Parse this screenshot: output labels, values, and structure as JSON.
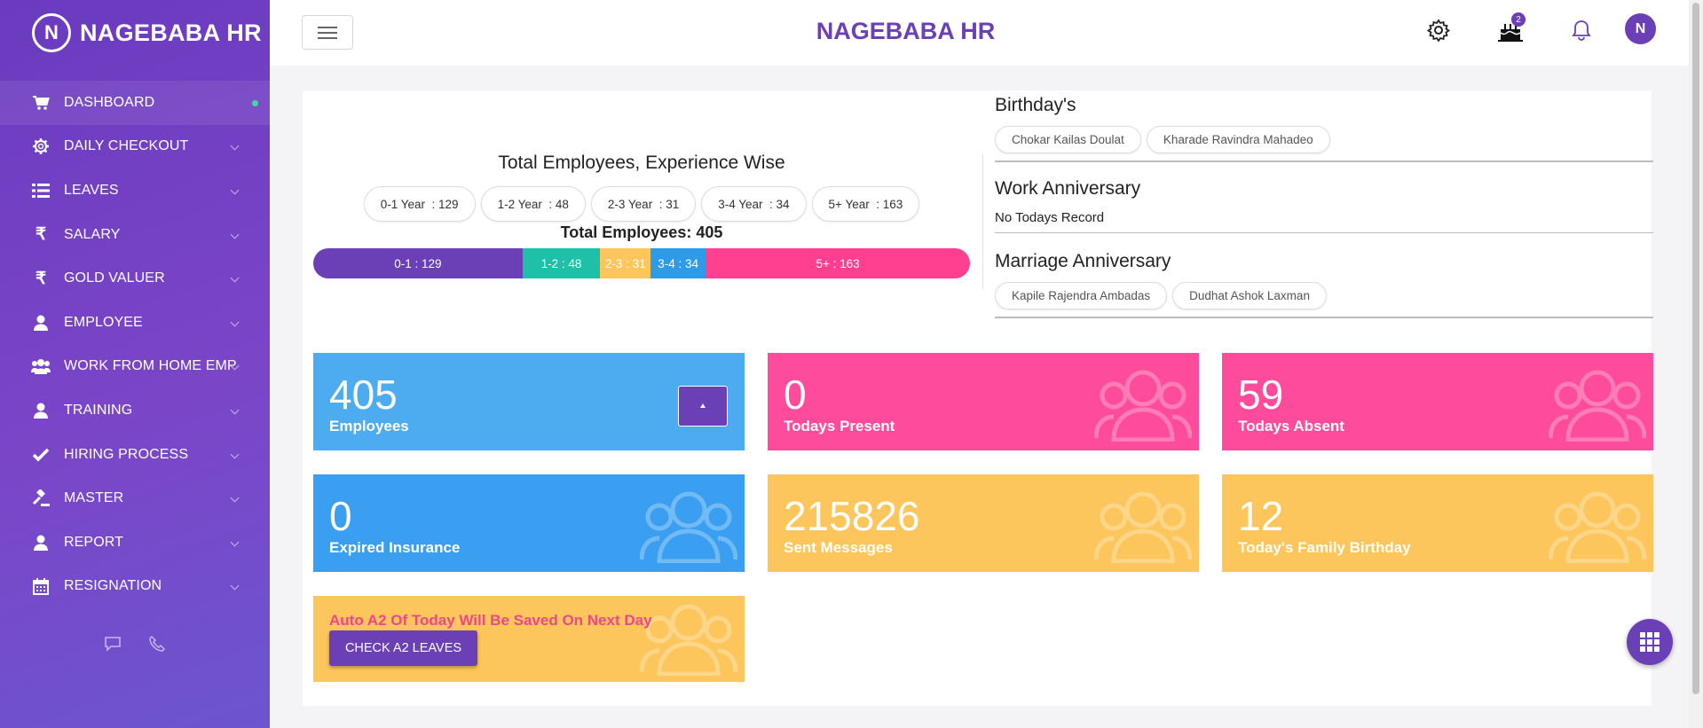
{
  "brand": {
    "logo_letter": "N",
    "name": "NAGEBABA HR"
  },
  "sidebar": {
    "items": [
      {
        "label": "DASHBOARD",
        "icon": "cart-icon"
      },
      {
        "label": "DAILY CHECKOUT",
        "icon": "gear-icon"
      },
      {
        "label": "LEAVES",
        "icon": "list-icon"
      },
      {
        "label": "SALARY",
        "icon": "rupee-icon"
      },
      {
        "label": "GOLD VALUER",
        "icon": "rupee-icon"
      },
      {
        "label": "EMPLOYEE",
        "icon": "user-icon"
      },
      {
        "label": "WORK FROM HOME EMP",
        "icon": "users-icon"
      },
      {
        "label": "TRAINING",
        "icon": "user-icon"
      },
      {
        "label": "HIRING PROCESS",
        "icon": "check-icon"
      },
      {
        "label": "MASTER",
        "icon": "gavel-icon"
      },
      {
        "label": "REPORT",
        "icon": "user-icon"
      },
      {
        "label": "RESIGNATION",
        "icon": "calendar-icon"
      }
    ]
  },
  "topbar": {
    "title": "NAGEBABA HR",
    "birthday_badge": "2",
    "avatar_letter": "N"
  },
  "experience": {
    "title": "Total Employees, Experience Wise",
    "pills": [
      "0-1 Year  : 129",
      "1-2 Year  : 48",
      "2-3 Year  : 31",
      "3-4 Year  : 34",
      "5+ Year  : 163"
    ],
    "total": "Total Employees: 405",
    "segments": [
      {
        "label": "0-1 : 129",
        "value": 129,
        "color": "#6b3fb5"
      },
      {
        "label": "1-2 : 48",
        "value": 48,
        "color": "#1fc0a8"
      },
      {
        "label": "2-3 : 31",
        "value": 31,
        "color": "#fdc65c"
      },
      {
        "label": "3-4 : 34",
        "value": 34,
        "color": "#2e9be8"
      },
      {
        "label": "5+ : 163",
        "value": 163,
        "color": "#ff3f8f"
      }
    ]
  },
  "events": {
    "birthdays": {
      "title": "Birthday's",
      "names": [
        "Chokar Kailas Doulat",
        "Kharade Ravindra Mahadeo"
      ]
    },
    "work_anniversary": {
      "title": "Work Anniversary",
      "text": "No Todays Record"
    },
    "marriage_anniversary": {
      "title": "Marriage Anniversary",
      "names": [
        "Kapile Rajendra Ambadas",
        "Dudhat Ashok Laxman"
      ]
    }
  },
  "cards": [
    {
      "value": "405",
      "label": "Employees",
      "color": "#4dabf0"
    },
    {
      "value": "0",
      "label": "Todays Present",
      "color": "#ff4b9b"
    },
    {
      "value": "59",
      "label": "Todays Absent",
      "color": "#ff4b9b"
    },
    {
      "value": "0",
      "label": "Expired Insurance",
      "color": "#3a9ff0"
    },
    {
      "value": "215826",
      "label": "Sent Messages",
      "color": "#fdc65c"
    },
    {
      "value": "12",
      "label": "Today's Family Birthday",
      "color": "#fdc65c"
    }
  ],
  "notice": {
    "text": "Auto A2 Of Today Will Be Saved On Next Day",
    "button": "CHECK A2 LEAVES"
  }
}
